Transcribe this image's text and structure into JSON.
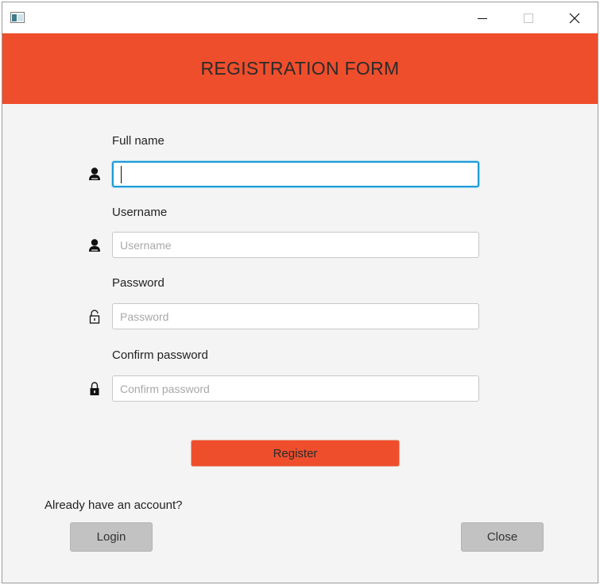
{
  "window": {
    "controls": {
      "minimize_icon": "minimize-icon",
      "maximize_icon": "maximize-icon",
      "close_icon": "close-icon"
    }
  },
  "header": {
    "title": "REGISTRATION FORM",
    "color": "#ef4e2c"
  },
  "form": {
    "full_name": {
      "label": "Full name",
      "value": "",
      "placeholder": "",
      "icon": "user-icon",
      "focused": true
    },
    "username": {
      "label": "Username",
      "value": "",
      "placeholder": "Username",
      "icon": "user-icon"
    },
    "password": {
      "label": "Password",
      "value": "",
      "placeholder": "Password",
      "icon": "unlock-icon"
    },
    "confirm_password": {
      "label": "Confirm password",
      "value": "",
      "placeholder": "Confirm password",
      "icon": "lock-icon"
    },
    "register_label": "Register"
  },
  "footer": {
    "prompt": "Already have an account?",
    "login_label": "Login",
    "close_label": "Close"
  }
}
